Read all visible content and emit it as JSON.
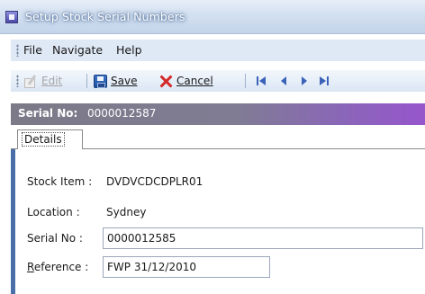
{
  "window": {
    "title": "Setup Stock Serial Numbers"
  },
  "menu": {
    "items": [
      "File",
      "Navigate",
      "Help"
    ]
  },
  "toolbar": {
    "edit_label": "Edit",
    "save_label": "Save",
    "cancel_label": "Cancel",
    "nav_buttons": [
      "first-record-icon",
      "previous-record-icon",
      "next-record-icon",
      "last-record-icon"
    ]
  },
  "record_header": {
    "label": "Serial No:",
    "value": "0000012587"
  },
  "tabs": [
    {
      "label": "Details",
      "selected": true
    }
  ],
  "form": {
    "stock_item": {
      "label": "Stock Item :",
      "value": "DVDVCDCDPLR01"
    },
    "location": {
      "label": "Location :",
      "value": "Sydney"
    },
    "serial_no": {
      "label": "Serial No :",
      "value": "0000012585"
    },
    "reference": {
      "label": "Reference :",
      "value": "FWP 31/12/2010"
    }
  },
  "colors": {
    "accent_left": "#4a6fa8",
    "header_end": "#9656cc"
  }
}
